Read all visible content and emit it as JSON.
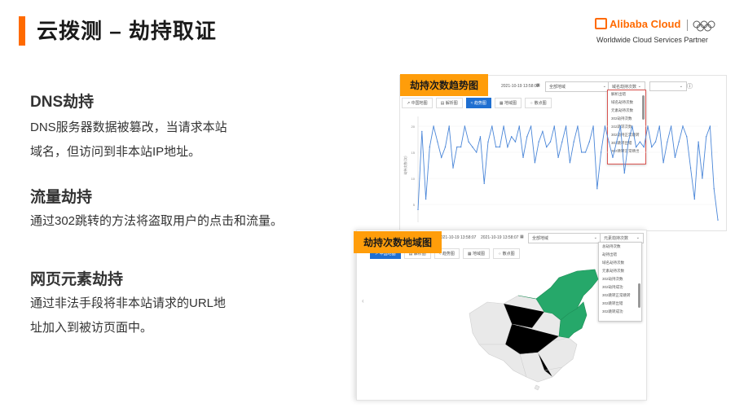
{
  "slide": {
    "title": "云拨测 – 劫持取证"
  },
  "brand": {
    "logo_text": "Alibaba Cloud",
    "tagline": "Worldwide Cloud Services Partner"
  },
  "sections": [
    {
      "heading": "DNS劫持",
      "lines": [
        "DNS服务器数据被篡改，当请求本站",
        "域名，但访问到非本站IP地址。"
      ]
    },
    {
      "heading": "流量劫持",
      "lines": [
        "通过302跳转的方法将盗取用户的点击和流量。"
      ]
    },
    {
      "heading": "网页元素劫持",
      "lines": [
        "通过非法手段将非本站请求的URL地",
        "址加入到被访页面中。"
      ]
    }
  ],
  "panel1": {
    "label": "劫持次数趋势图",
    "time": "2021-10-19 13:58:07",
    "region_select": "全部地域",
    "metric_select": "域名劫持次数",
    "toolbar": [
      "中国地图",
      "解析图",
      "趋势图",
      "地域图",
      "散点图"
    ],
    "active_tab": "趋势图",
    "dropdown_items": [
      "解析出错",
      "域名劫持次数",
      "元素劫持次数",
      "302劫持次数",
      "302跳转次数",
      "302劫持正常跳转",
      "302跳转出错",
      "302跳转正常跳出"
    ],
    "y_ticks": [
      "20",
      "15",
      "10",
      "5"
    ],
    "y_axis_label": "劫持次数(次)",
    "icon_names": [
      "calendar-icon",
      "chevron-down-icon",
      "info-icon"
    ]
  },
  "panel2": {
    "label": "劫持次数地域图",
    "time_start": "2021-10-19 13:58:07",
    "time_end": "2021-10-19 13:58:07",
    "region_select": "全部地域",
    "metric_select": "元素劫持次数",
    "toolbar": [
      "中国地图",
      "解析图",
      "趋势图",
      "地域图",
      "散点图"
    ],
    "active_tab": "中国地图",
    "dropdown_items": [
      "总劫持次数",
      "劫持出错",
      "域名劫持次数",
      "元素劫持次数",
      "302劫持次数",
      "302劫持成功",
      "302跳转正常跳转",
      "302跳转出错",
      "302跳转成功"
    ],
    "highlight_color": "#26a86a",
    "map_color": "#e9e9e9"
  },
  "chart_data": {
    "type": "line",
    "title": "",
    "ylabel": "劫持次数(次)",
    "ylim": [
      5,
      20
    ],
    "series": [
      {
        "values": [
          4,
          19,
          6,
          16,
          20,
          17,
          14,
          16,
          20,
          12,
          16,
          16,
          20,
          17,
          16,
          15,
          18,
          9,
          17,
          20,
          16,
          16,
          20,
          16,
          18,
          17,
          20,
          14,
          18,
          20,
          13,
          17,
          19,
          16,
          17,
          20,
          14,
          17,
          20,
          13,
          17,
          20,
          15,
          15,
          17,
          20,
          8,
          15,
          20,
          17,
          14,
          17,
          20,
          11,
          17,
          20,
          16,
          17,
          16,
          20,
          16,
          17,
          20,
          13,
          17,
          20,
          14,
          17,
          20,
          18,
          12,
          6,
          17,
          10,
          18,
          20,
          8,
          2
        ]
      }
    ]
  }
}
